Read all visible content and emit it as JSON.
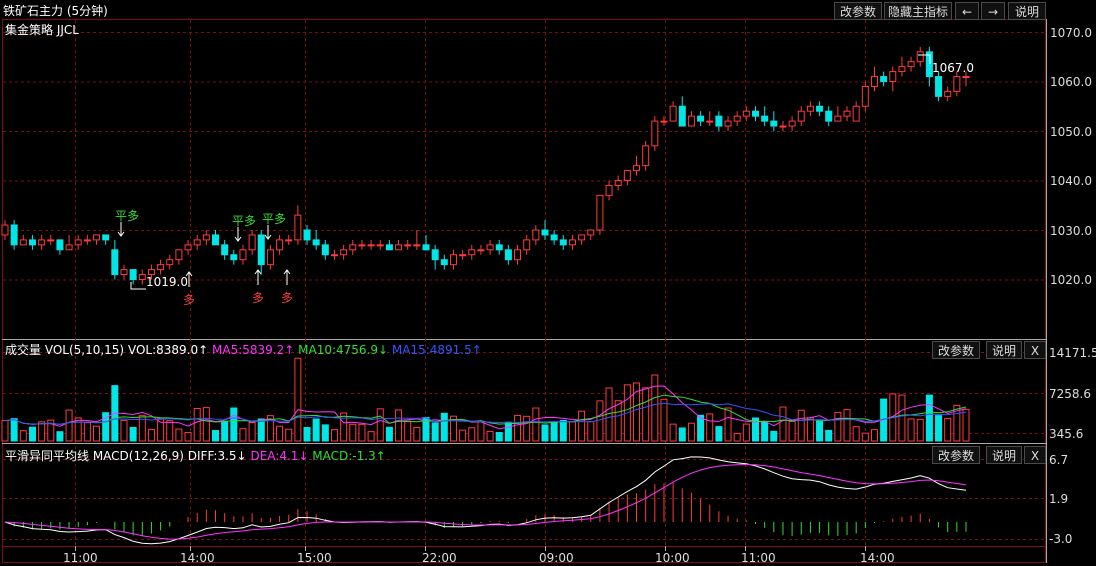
{
  "title": "铁矿石主力 (5分钟)",
  "toolbar": {
    "change_params": "改参数",
    "hide_indicator": "隐藏主指标",
    "back_arrow": "←",
    "fwd_arrow": "→",
    "help": "说明"
  },
  "strategy_label": "集金策略 JJCL",
  "price_axis": [
    "1070.0",
    "1060.0",
    "1050.0",
    "1040.0",
    "1030.0",
    "1020.0"
  ],
  "signals": {
    "ping_duo": "平多",
    "duo": "多"
  },
  "low_label": "1019.0",
  "high_label": "1067.0",
  "volume": {
    "name": "成交量 VOL(5,10,15)",
    "vol": "VOL:8389.0↑",
    "ma5": "MA5:5839.2↑",
    "ma10": "MA10:4756.9↓",
    "ma15": "MA15:4891.5↑",
    "axis": [
      "14171.5",
      "7258.6",
      "345.6"
    ],
    "btn_params": "改参数",
    "btn_help": "说明",
    "btn_close": "X"
  },
  "macd": {
    "name": "平滑异同平均线 MACD(12,26,9)",
    "diff": "DIFF:3.5↓",
    "dea": "DEA:4.1↓",
    "macd": "MACD:-1.3↑",
    "axis": [
      "6.7",
      "1.9",
      "-3.0"
    ],
    "btn_params": "改参数",
    "btn_help": "说明",
    "btn_close": "X"
  },
  "time_axis": [
    "11:00",
    "14:00",
    "15:00",
    "22:00",
    "09:00",
    "10:00",
    "11:00",
    "14:00"
  ],
  "colors": {
    "up": "#ff3b3b",
    "down": "#00e6e6",
    "ma5": "#ff33ff",
    "ma10": "#33dd33",
    "ma15": "#3355ff",
    "grid": "#7a1010",
    "signal_green": "#33dd33",
    "signal_red": "#ff3b3b"
  },
  "chart_data": {
    "type": "candlestick",
    "candles_ohlc": [
      [
        1029,
        1032,
        1028,
        1031
      ],
      [
        1031,
        1032,
        1026,
        1027
      ],
      [
        1027,
        1029,
        1027,
        1028
      ],
      [
        1028,
        1029,
        1026,
        1027
      ],
      [
        1027,
        1029,
        1026,
        1028
      ],
      [
        1028,
        1029,
        1027,
        1028
      ],
      [
        1028,
        1028,
        1025,
        1026
      ],
      [
        1026,
        1029,
        1026,
        1027
      ],
      [
        1027,
        1029,
        1026,
        1028
      ],
      [
        1028,
        1029,
        1027,
        1028
      ],
      [
        1028,
        1029,
        1027,
        1029
      ],
      [
        1029,
        1029,
        1027,
        1028
      ],
      [
        1026,
        1028,
        1020,
        1021
      ],
      [
        1021,
        1023,
        1020,
        1022
      ],
      [
        1022,
        1022,
        1019,
        1020
      ],
      [
        1020,
        1022,
        1019,
        1021
      ],
      [
        1021,
        1023,
        1020,
        1022
      ],
      [
        1022,
        1024,
        1021,
        1023
      ],
      [
        1023,
        1025,
        1022,
        1024
      ],
      [
        1024,
        1026,
        1023,
        1026
      ],
      [
        1026,
        1028,
        1025,
        1027
      ],
      [
        1027,
        1029,
        1026,
        1028
      ],
      [
        1028,
        1030,
        1027,
        1029
      ],
      [
        1029,
        1030,
        1027,
        1027
      ],
      [
        1027,
        1028,
        1024,
        1025
      ],
      [
        1025,
        1026,
        1023,
        1024
      ],
      [
        1024,
        1027,
        1023,
        1026
      ],
      [
        1026,
        1030,
        1025,
        1029
      ],
      [
        1029,
        1030,
        1021,
        1023
      ],
      [
        1023,
        1027,
        1022,
        1026
      ],
      [
        1026,
        1029,
        1025,
        1028
      ],
      [
        1028,
        1029,
        1027,
        1028
      ],
      [
        1028,
        1035,
        1027,
        1033
      ],
      [
        1030,
        1031,
        1027,
        1028
      ],
      [
        1028,
        1030,
        1026,
        1027
      ],
      [
        1027,
        1028,
        1024,
        1025
      ],
      [
        1025,
        1026,
        1024,
        1025
      ],
      [
        1025,
        1027,
        1024,
        1026
      ],
      [
        1026,
        1028,
        1025,
        1027
      ],
      [
        1027,
        1028,
        1026,
        1027
      ],
      [
        1027,
        1028,
        1026,
        1027
      ],
      [
        1027,
        1028,
        1026,
        1027
      ],
      [
        1027,
        1028,
        1026,
        1026
      ],
      [
        1026,
        1028,
        1026,
        1027
      ],
      [
        1027,
        1028,
        1026,
        1027
      ],
      [
        1027,
        1030,
        1026,
        1027
      ],
      [
        1027,
        1029,
        1026,
        1026
      ],
      [
        1026,
        1027,
        1022,
        1024
      ],
      [
        1024,
        1025,
        1022,
        1023
      ],
      [
        1023,
        1026,
        1022,
        1025
      ],
      [
        1025,
        1026,
        1024,
        1025
      ],
      [
        1025,
        1027,
        1024,
        1026
      ],
      [
        1026,
        1027,
        1025,
        1026
      ],
      [
        1026,
        1028,
        1025,
        1027
      ],
      [
        1027,
        1028,
        1025,
        1026
      ],
      [
        1026,
        1027,
        1023,
        1024
      ],
      [
        1024,
        1027,
        1023,
        1026
      ],
      [
        1026,
        1029,
        1025,
        1028
      ],
      [
        1028,
        1031,
        1027,
        1030
      ],
      [
        1030,
        1032,
        1028,
        1029
      ],
      [
        1029,
        1030,
        1027,
        1028
      ],
      [
        1028,
        1029,
        1026,
        1027
      ],
      [
        1027,
        1029,
        1026,
        1028
      ],
      [
        1028,
        1029,
        1027,
        1029
      ],
      [
        1029,
        1030,
        1028,
        1030
      ],
      [
        1030,
        1037,
        1029,
        1037
      ],
      [
        1037,
        1040,
        1036,
        1039
      ],
      [
        1039,
        1041,
        1038,
        1040
      ],
      [
        1040,
        1042,
        1039,
        1042
      ],
      [
        1042,
        1045,
        1041,
        1043
      ],
      [
        1043,
        1048,
        1042,
        1047
      ],
      [
        1047,
        1053,
        1046,
        1052
      ],
      [
        1052,
        1053,
        1051,
        1052
      ],
      [
        1052,
        1056,
        1052,
        1055
      ],
      [
        1055,
        1057,
        1051,
        1051
      ],
      [
        1051,
        1054,
        1051,
        1053
      ],
      [
        1053,
        1054,
        1051,
        1052
      ],
      [
        1052,
        1054,
        1051,
        1052
      ],
      [
        1053,
        1054,
        1050,
        1051
      ],
      [
        1051,
        1053,
        1050,
        1052
      ],
      [
        1052,
        1054,
        1051,
        1053
      ],
      [
        1053,
        1055,
        1052,
        1054
      ],
      [
        1054,
        1055,
        1052,
        1053
      ],
      [
        1053,
        1055,
        1051,
        1052
      ],
      [
        1052,
        1054,
        1050,
        1051
      ],
      [
        1051,
        1052,
        1050,
        1051
      ],
      [
        1051,
        1053,
        1050,
        1052
      ],
      [
        1052,
        1055,
        1051,
        1054
      ],
      [
        1054,
        1056,
        1053,
        1055
      ],
      [
        1055,
        1056,
        1053,
        1054
      ],
      [
        1054,
        1055,
        1051,
        1052
      ],
      [
        1052,
        1055,
        1052,
        1053
      ],
      [
        1053,
        1055,
        1052,
        1054
      ],
      [
        1052,
        1056,
        1052,
        1055
      ],
      [
        1055,
        1060,
        1054,
        1059
      ],
      [
        1059,
        1063,
        1058,
        1061
      ],
      [
        1061,
        1062,
        1059,
        1060
      ],
      [
        1060,
        1063,
        1058,
        1062
      ],
      [
        1062,
        1065,
        1061,
        1063
      ],
      [
        1063,
        1065,
        1062,
        1064
      ],
      [
        1064,
        1067,
        1063,
        1066
      ],
      [
        1066,
        1067,
        1059,
        1061
      ],
      [
        1061,
        1062,
        1056,
        1057
      ],
      [
        1057,
        1059,
        1056,
        1058
      ],
      [
        1058,
        1062,
        1057,
        1061
      ],
      [
        1061,
        1062,
        1059,
        1061
      ]
    ],
    "price_range": [
      1010,
      1072
    ]
  }
}
